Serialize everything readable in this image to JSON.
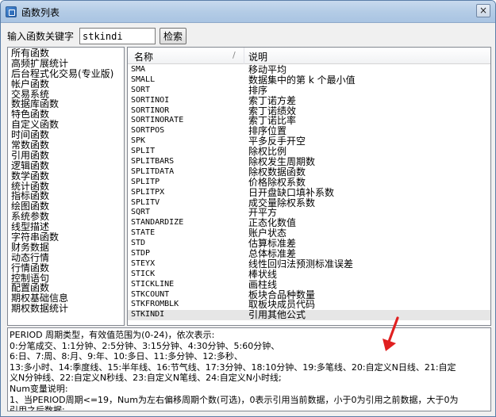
{
  "window": {
    "title": "函数列表",
    "close_glyph": "×"
  },
  "search": {
    "label": "输入函数关键字",
    "value": "stkindi",
    "button": "检索"
  },
  "categories": [
    "所有函数",
    "高频扩展统计",
    "后台程式化交易(专业版)",
    "帐户函数",
    "交易系统",
    "数据库函数",
    "特色函数",
    "自定义函数",
    "时间函数",
    "常数函数",
    "引用函数",
    "逻辑函数",
    "数学函数",
    "统计函数",
    "指标函数",
    "绘图函数",
    "系统参数",
    "线型描述",
    "字符串函数",
    "财务数据",
    "动态行情",
    "行情函数",
    "控制语句",
    "配置函数",
    "期权基础信息",
    "期权数据统计"
  ],
  "table": {
    "columns": {
      "name": "名称",
      "sort_mark": "/",
      "desc": "说明"
    },
    "rows": [
      {
        "name": "SMA",
        "desc": "移动平均"
      },
      {
        "name": "SMALL",
        "desc": "数据集中的第 k 个最小值"
      },
      {
        "name": "SORT",
        "desc": "排序"
      },
      {
        "name": "SORTINOI",
        "desc": "索丁诺方差"
      },
      {
        "name": "SORTINOR",
        "desc": "索丁诺绩效"
      },
      {
        "name": "SORTINORATE",
        "desc": "索丁诺比率"
      },
      {
        "name": "SORTPOS",
        "desc": "排序位置"
      },
      {
        "name": "SPK",
        "desc": "平多反手开空"
      },
      {
        "name": "SPLIT",
        "desc": "除权比例"
      },
      {
        "name": "SPLITBARS",
        "desc": "除权发生周期数"
      },
      {
        "name": "SPLITDATA",
        "desc": "除权数据函数"
      },
      {
        "name": "SPLITP",
        "desc": "价格除权系数"
      },
      {
        "name": "SPLITPX",
        "desc": "日开盘缺口填补系数"
      },
      {
        "name": "SPLITV",
        "desc": "成交量除权系数"
      },
      {
        "name": "SQRT",
        "desc": "开平方"
      },
      {
        "name": "STANDARDIZE",
        "desc": "正态化数值"
      },
      {
        "name": "STATE",
        "desc": "账户状态"
      },
      {
        "name": "STD",
        "desc": "估算标准差"
      },
      {
        "name": "STDP",
        "desc": "总体标准差"
      },
      {
        "name": "STEYX",
        "desc": "线性回归法预测标准误差"
      },
      {
        "name": "STICK",
        "desc": "棒状线"
      },
      {
        "name": "STICKLINE",
        "desc": "画柱线"
      },
      {
        "name": "STKCOUNT",
        "desc": "板块合品种数量"
      },
      {
        "name": "STKFROMBLK",
        "desc": "取板块成员代码"
      },
      {
        "name": "STKINDI",
        "desc": "引用其他公式"
      }
    ],
    "selected_index": 24
  },
  "detail": {
    "lines": [
      "PERIOD 周期类型，有效值范围为(0-24)，依次表示:",
      "0:分笔成交、1:1分钟、2:5分钟、3:15分钟、4:30分钟、5:60分钟、",
      "6:日、7:周、8:月、9:年、10:多日、11:多分钟、12:多秒、",
      "13:多小时、14:季度线、15:半年线、16:节气线、17:3分钟、18:10分钟、19:多笔线、20:自定义N日线、21:自定",
      "义N分钟线、22:自定义N秒线、23:自定义N笔线、24:自定义N小时线;",
      "Num变量说明:",
      "1、当PERIOD周期<=19，Num为左右偏移周期个数(可选)，0表示引用当前数据，小于0为引用之前数据，大于0为",
      "引用之后数据;"
    ]
  },
  "colors": {
    "annotation_arrow": "#e02020"
  }
}
